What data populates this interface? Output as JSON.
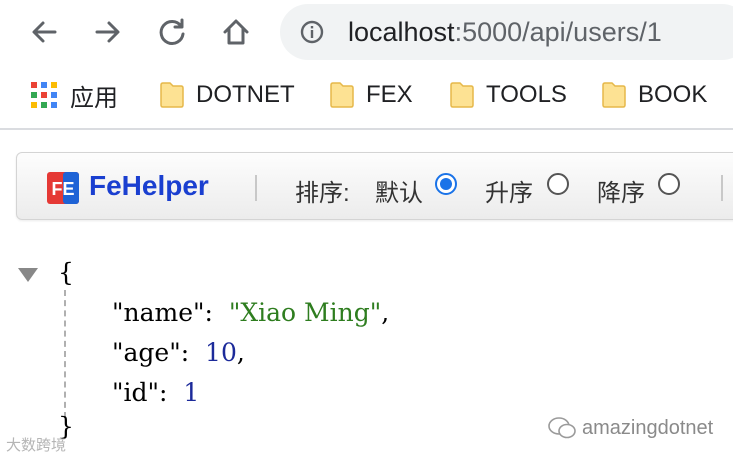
{
  "nav": {
    "back_icon": "arrow-left-icon",
    "forward_icon": "arrow-right-icon",
    "reload_icon": "reload-icon",
    "home_icon": "home-icon",
    "info_icon": "info-icon",
    "url_host": "localhost",
    "url_rest": ":5000/api/users/1"
  },
  "bookmarks": {
    "apps_label": "应用",
    "items": [
      {
        "label": "DOTNET"
      },
      {
        "label": "FEX"
      },
      {
        "label": "TOOLS"
      },
      {
        "label": "BOOK"
      }
    ]
  },
  "fehelper": {
    "logo_text": "FE",
    "title": "FeHelper",
    "sort_label": "排序:",
    "options": [
      {
        "label": "默认",
        "checked": true
      },
      {
        "label": "升序",
        "checked": false
      },
      {
        "label": "降序",
        "checked": false
      }
    ],
    "accent": "#1a3fd0"
  },
  "json": {
    "open_brace": "{",
    "close_brace": "}",
    "fields": [
      {
        "key": "\"name\"",
        "colon": ":",
        "value": "\"Xiao Ming\"",
        "comma": ",",
        "type": "string"
      },
      {
        "key": "\"age\"",
        "colon": ":",
        "value": "10",
        "comma": ",",
        "type": "number"
      },
      {
        "key": "\"id\"",
        "colon": ":",
        "value": "1",
        "comma": "",
        "type": "number"
      }
    ]
  },
  "watermark": {
    "left_text": "大数跨境",
    "right_text": "amazingdotnet"
  }
}
